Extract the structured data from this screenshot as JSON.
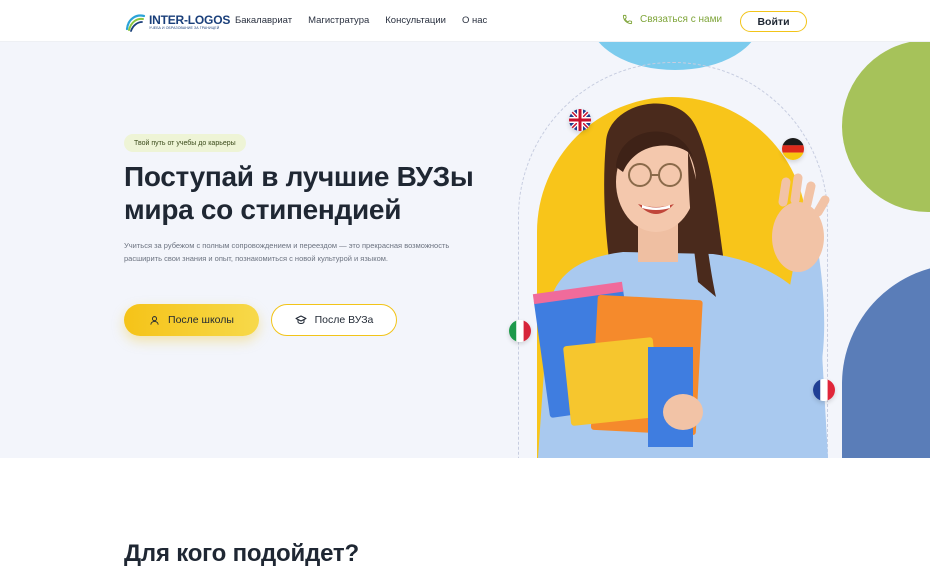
{
  "header": {
    "logo": {
      "name": "INTER-LOGOS",
      "tagline": "УЧЕБА И ОБРАЗОВАНИЕ ЗА ГРАНИЦЕЙ"
    },
    "nav": [
      {
        "label": "Бакалавриат"
      },
      {
        "label": "Магистратура"
      },
      {
        "label": "Консультации"
      },
      {
        "label": "О нас"
      }
    ],
    "contact_label": "Связаться с нами",
    "login_label": "Войти"
  },
  "hero": {
    "badge": "Твой путь от учебы до карьеры",
    "title_line1": "Поступай в лучшие ВУЗы",
    "title_line2": "мира со стипендией",
    "subtitle": "Учиться за рубежом с полным сопровождением и переездом — это прекрасная возможность расширить свои знания и опыт, познакомиться с новой культурой и языком.",
    "primary_button": "После школы",
    "secondary_button": "После ВУЗа",
    "flags": [
      "uk-flag",
      "germany-flag",
      "italy-flag",
      "france-flag"
    ]
  },
  "section": {
    "title": "Для кого подойдет?"
  },
  "colors": {
    "accent_yellow": "#f5c318",
    "accent_green": "#a6c25a",
    "accent_blue": "#7ccbed",
    "accent_navy": "#5a7db8",
    "brand_blue": "#1a3f7a",
    "contact_green": "#7fa53a"
  }
}
